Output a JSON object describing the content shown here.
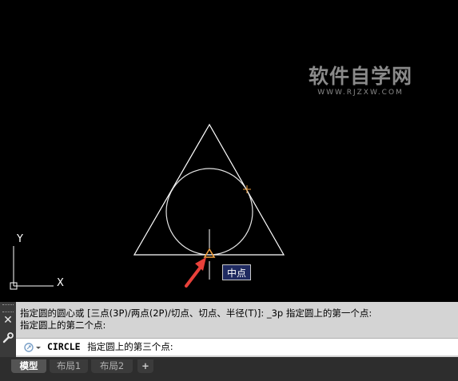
{
  "watermark": {
    "title": "软件自学网",
    "url": "WWW.RJZXW.COM"
  },
  "canvas": {
    "ucs_y_label": "Y",
    "ucs_x_label": "X",
    "snap_tooltip": "中点"
  },
  "command_panel": {
    "history_line1": "指定圆的圆心或 [三点(3P)/两点(2P)/切点、切点、半径(T)]: _3p 指定圆上的第一个点:",
    "history_line2": "指定圆上的第二个点:",
    "command_name": "CIRCLE",
    "command_prompt": "指定圆上的第三个点:"
  },
  "tabs": [
    {
      "label": "模型",
      "active": true
    },
    {
      "label": "布局1",
      "active": false
    },
    {
      "label": "布局2",
      "active": false
    },
    {
      "label": "+",
      "active": false
    }
  ],
  "colors": {
    "canvas_background": "#000000",
    "geometry": "#ffffff",
    "osnap_marker": "#f0a040",
    "arrow": "#e8413a",
    "tooltip_background": "#1f2a60"
  }
}
